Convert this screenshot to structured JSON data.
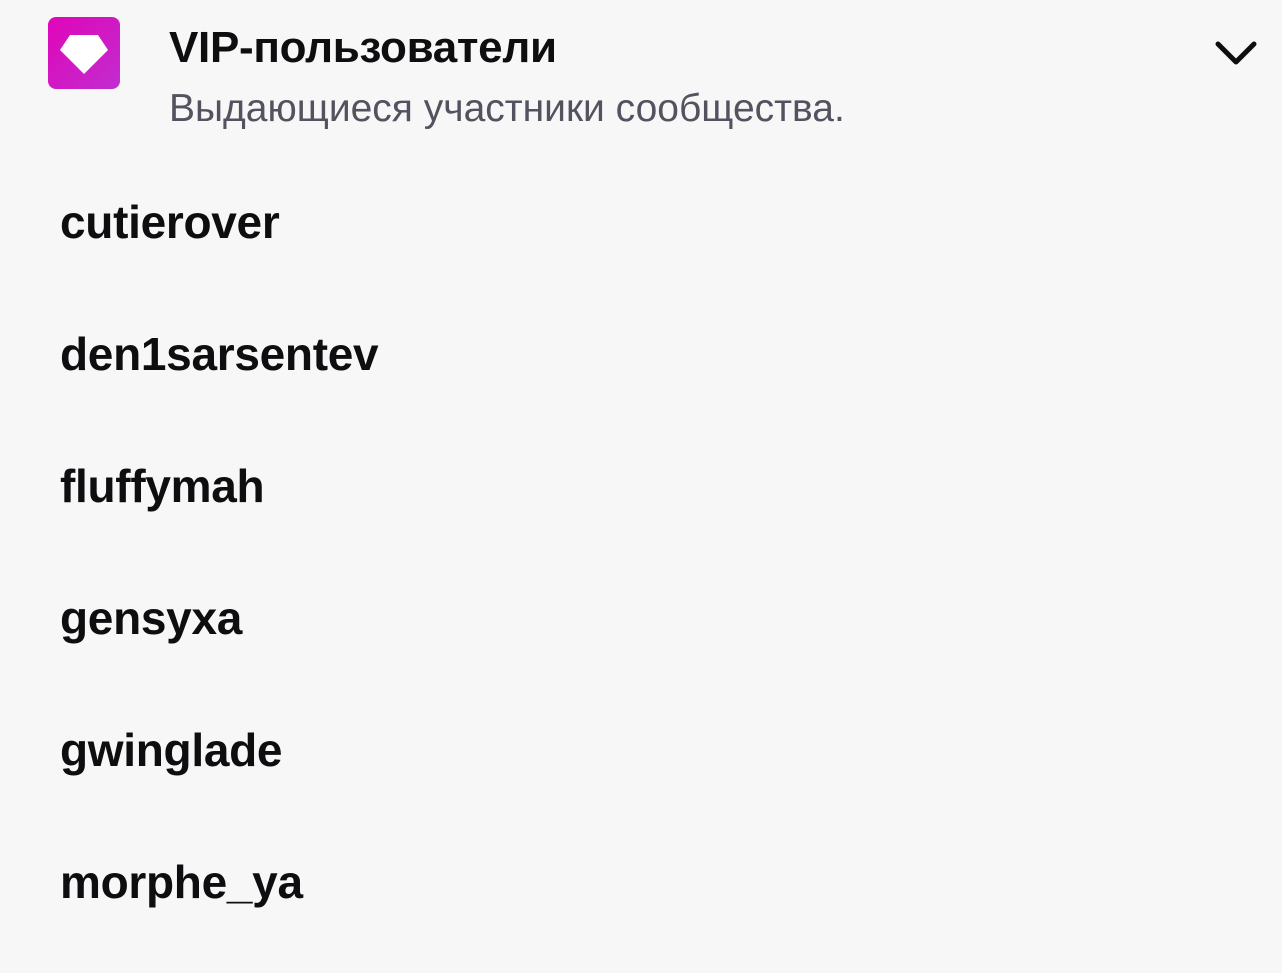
{
  "header": {
    "badge_icon": "vip-diamond-icon",
    "badge_color": "#e005b9",
    "title": "VIP-пользователи",
    "subtitle": "Выдающиеся участники сообщества.",
    "toggle_icon": "chevron-down-icon"
  },
  "vip_users": [
    {
      "name": "cutierover"
    },
    {
      "name": "den1sarsentev"
    },
    {
      "name": "fluffymah"
    },
    {
      "name": "gensyxa"
    },
    {
      "name": "gwinglade"
    },
    {
      "name": "morphe_ya"
    }
  ],
  "colors": {
    "background": "#f7f7f8",
    "text": "#0e0e10",
    "subtitle": "#53535f"
  }
}
